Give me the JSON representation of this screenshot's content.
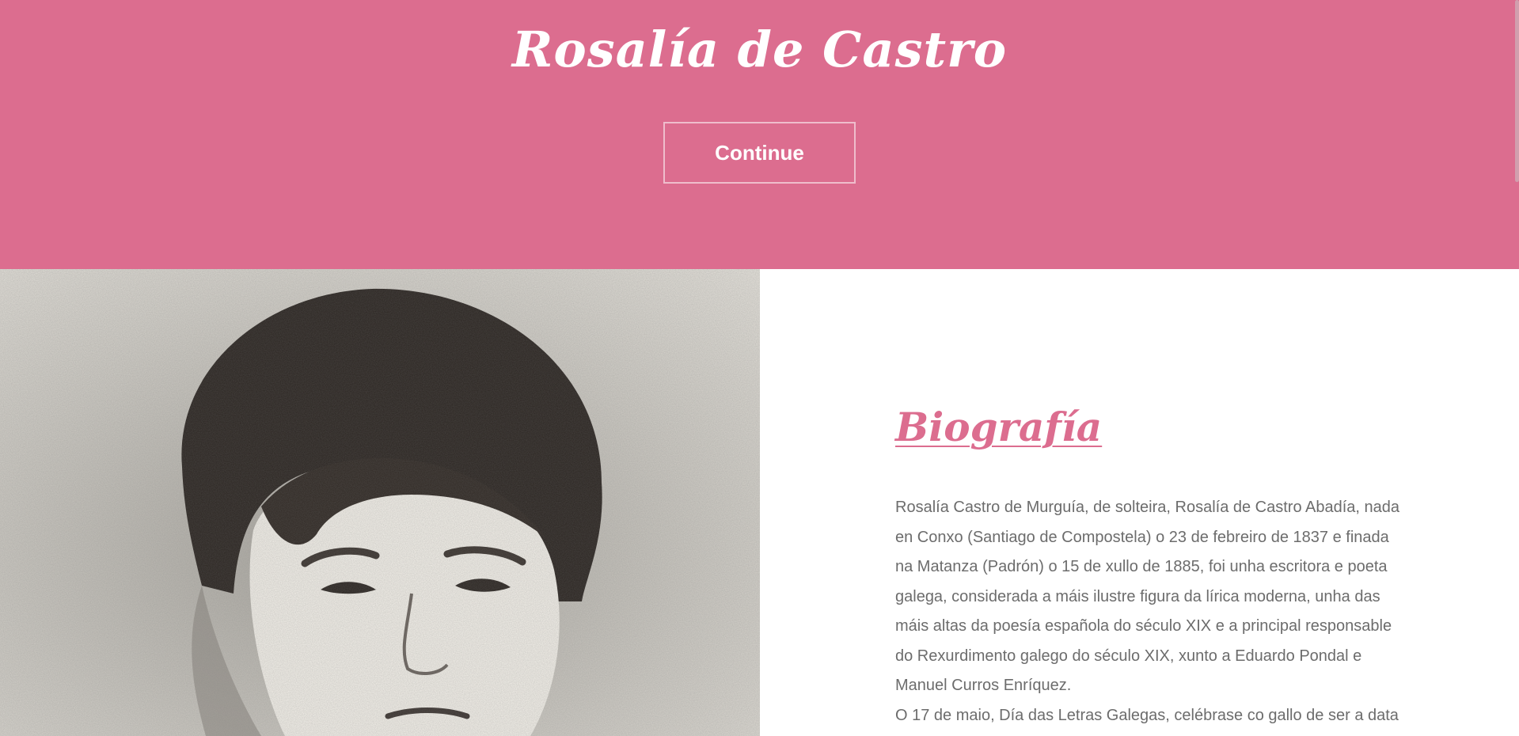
{
  "hero": {
    "title": "Rosalía de Castro",
    "continue_label": "Continue",
    "background_color": "#dc6d8f"
  },
  "biography": {
    "heading": "Biografía",
    "paragraph_1": "Rosalía Castro de Murguía, de solteira, Rosalía de Castro Abadía, nada en Conxo (Santiago de Compostela) o 23 de febreiro de 1837 e finada na Matanza (Padrón) o 15 de xullo de 1885, foi unha escritora e poeta galega, considerada a máis ilustre figura da lírica moderna, unha das máis altas da poesía española do século XIX e a principal responsable do Rexurdimento galego do século XIX, xunto a Eduardo Pondal e Manuel Curros Enríquez.",
    "paragraph_2": "O 17 de maio, Día das Letras Galegas, celébrase co gallo de ser a data"
  },
  "colors": {
    "accent": "#dc6d8f",
    "body_text": "#6c6c6c"
  },
  "icons": {
    "portrait": "portrait-photo"
  }
}
